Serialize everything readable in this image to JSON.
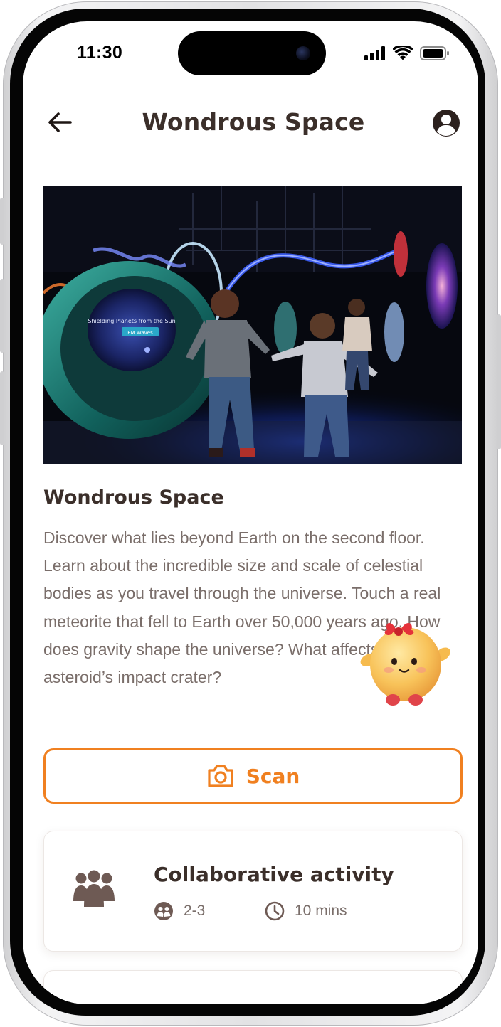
{
  "status_bar": {
    "time": "11:30"
  },
  "header": {
    "title": "Wondrous Space",
    "back_icon": "arrow-left-icon",
    "profile_icon": "user-circle-icon"
  },
  "hero": {
    "screen_text": "Shielding Planets from the Sun",
    "screen_badge": "EM Waves"
  },
  "exhibit": {
    "title": "Wondrous Space",
    "description": "Discover what lies beyond Earth on the second floor. Learn about the incredible size and scale of celestial bodies as you travel through the universe. Touch a real meteorite that fell to Earth over 50,000 years ago. How does gravity shape the universe? What affects an asteroid’s impact crater?"
  },
  "scan_button": {
    "label": "Scan",
    "icon": "camera-icon"
  },
  "activities": [
    {
      "title": "Collaborative activity",
      "icon": "group-icon",
      "group_size": "2-3",
      "group_icon": "people-icon",
      "duration": "10 mins",
      "duration_icon": "clock-icon"
    }
  ],
  "colors": {
    "accent": "#f08020",
    "heading": "#3b2f2a",
    "body_text": "#7a6e6a",
    "icon": "#6e5a54"
  }
}
